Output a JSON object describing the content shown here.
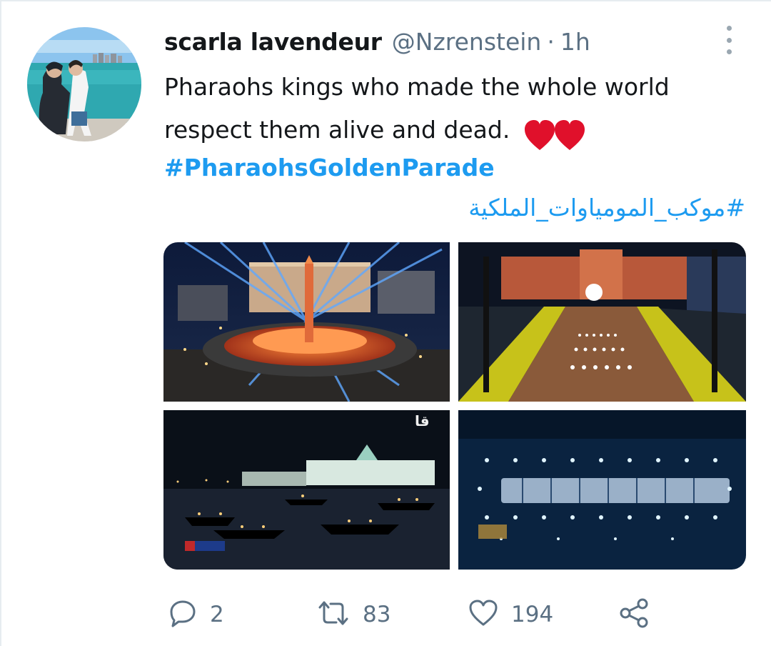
{
  "tweet": {
    "author": {
      "display_name": "scarla lavendeur",
      "handle": "@Nzrenstein",
      "separator": "·",
      "time": "1h"
    },
    "text": "Pharaohs kings who made the whole world respect them alive and dead.",
    "emoji": "❤❤",
    "hashtags": [
      "#PharaohsGoldenParade",
      "#موكب_المومياوات_الملكية"
    ],
    "photo_badge": "قا"
  },
  "actions": {
    "reply_count": "2",
    "retweet_count": "83",
    "like_count": "194"
  },
  "icons": {
    "reply": "reply-icon",
    "retweet": "retweet-icon",
    "like": "heart-outline-icon",
    "share": "share-icon",
    "more": "more-vertical-icon"
  },
  "colors": {
    "link": "#1d9bf0",
    "muted": "#5b7083",
    "text": "#14171a",
    "heart": "#e0102b"
  }
}
